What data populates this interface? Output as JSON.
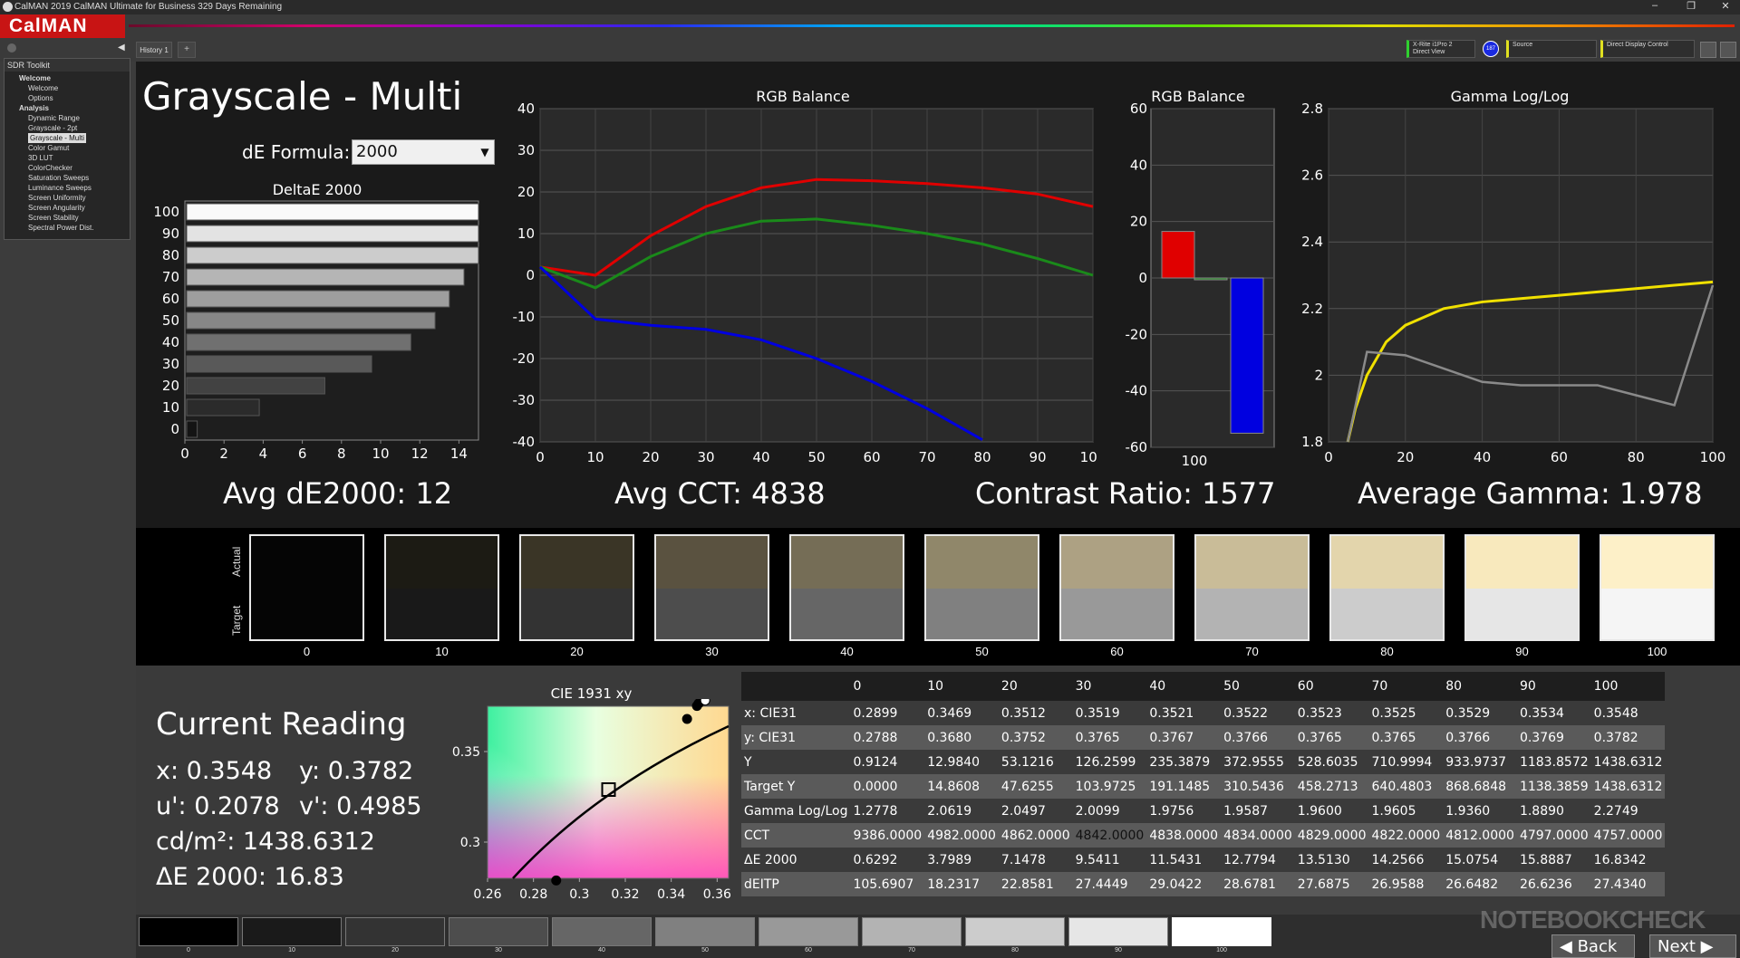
{
  "window": {
    "title": "CalMAN 2019 CalMAN Ultimate for Business 329 Days Remaining"
  },
  "brand": {
    "name": "CalMAN"
  },
  "sidebar": {
    "header": "SDR Toolkit",
    "items": [
      "Welcome",
      "Welcome",
      "Options",
      "Analysis",
      "Dynamic Range",
      "Grayscale - 2pt",
      "Grayscale - Multi",
      "Color Gamut",
      "3D LUT",
      "ColorChecker",
      "Saturation Sweeps",
      "Luminance Sweeps",
      "Screen Uniformity",
      "Screen Angularity",
      "Screen Stability",
      "Spectral Power Dist."
    ]
  },
  "tabs": {
    "history": "History 1",
    "add": "+"
  },
  "devices": {
    "meter": "X-Rite i1Pro 2",
    "meter_mode": "Direct View",
    "badge": "187",
    "source": "Source",
    "display": "Direct Display Control"
  },
  "page": {
    "title": "Grayscale - Multi",
    "de_formula_label": "dE Formula:",
    "de_formula_value": "2000"
  },
  "stats": {
    "avg_de": "Avg dE2000: 12",
    "avg_cct": "Avg CCT: 4838",
    "contrast": "Contrast Ratio: 1577",
    "avg_gamma": "Average Gamma: 1.978"
  },
  "colors": {
    "red": "#e00000",
    "green": "#1a8a1a",
    "blue": "#0000e0",
    "yellow": "#f0e000",
    "gray": "#8a8a8a",
    "brand": "#c81414"
  },
  "chart_data": [
    {
      "type": "bar",
      "title": "DeltaE 2000",
      "orientation": "horizontal",
      "categories": [
        "100",
        "90",
        "80",
        "70",
        "60",
        "50",
        "40",
        "30",
        "20",
        "10",
        "0"
      ],
      "values": [
        16.83,
        15.89,
        15.08,
        14.26,
        13.51,
        12.78,
        11.54,
        9.54,
        7.15,
        3.8,
        0.63
      ],
      "xlim": [
        0,
        15
      ],
      "xticks": [
        "0",
        "2",
        "4",
        "6",
        "8",
        "10",
        "12",
        "14"
      ]
    },
    {
      "type": "line",
      "title": "RGB Balance",
      "x": [
        0,
        10,
        20,
        30,
        40,
        50,
        60,
        70,
        80,
        90,
        100
      ],
      "series": [
        {
          "color": "red",
          "values": [
            2,
            0,
            9.5,
            16.5,
            21,
            23,
            22.7,
            22,
            21,
            19.5,
            16.5
          ]
        },
        {
          "color": "green",
          "values": [
            2,
            -3,
            4.5,
            10,
            13,
            13.5,
            12,
            10,
            7.5,
            4,
            0
          ]
        },
        {
          "color": "blue",
          "values": [
            2,
            -10.5,
            -12,
            -13,
            -15.5,
            -20,
            -25.5,
            -32,
            -39.5
          ]
        }
      ],
      "xlim": [
        0,
        100
      ],
      "ylim": [
        -40,
        40
      ],
      "xticks": [
        "0",
        "10",
        "20",
        "30",
        "40",
        "50",
        "60",
        "70",
        "80",
        "90",
        "100"
      ],
      "yticks": [
        "40",
        "30",
        "20",
        "10",
        "0",
        "-10",
        "-20",
        "-30",
        "-40"
      ]
    },
    {
      "type": "bar",
      "title": "RGB Balance",
      "categories": [
        "100"
      ],
      "series": [
        {
          "color": "red",
          "values": [
            16.5
          ]
        },
        {
          "color": "green",
          "values": [
            0
          ]
        },
        {
          "color": "blue",
          "values": [
            -55
          ]
        }
      ],
      "ylim": [
        -60,
        60
      ],
      "yticks": [
        "60",
        "40",
        "20",
        "0",
        "-20",
        "-40",
        "-60"
      ]
    },
    {
      "type": "line",
      "title": "Gamma Log/Log",
      "series": [
        {
          "color": "yellow",
          "x": [
            5,
            7,
            10,
            15,
            20,
            30,
            40,
            50,
            60,
            70,
            80,
            90,
            100
          ],
          "values": [
            1.8,
            1.9,
            2.0,
            2.1,
            2.15,
            2.2,
            2.22,
            2.23,
            2.24,
            2.25,
            2.26,
            2.27,
            2.28
          ]
        },
        {
          "color": "gray",
          "x": [
            5,
            10,
            20,
            30,
            40,
            50,
            60,
            70,
            80,
            90,
            100
          ],
          "values": [
            1.8,
            2.07,
            2.06,
            2.02,
            1.98,
            1.97,
            1.97,
            1.97,
            1.94,
            1.91,
            2.27
          ]
        }
      ],
      "xlim": [
        0,
        100
      ],
      "ylim": [
        1.8,
        2.8
      ],
      "xticks": [
        "0",
        "20",
        "40",
        "60",
        "80",
        "100"
      ],
      "yticks": [
        "2.8",
        "2.6",
        "2.4",
        "2.2",
        "2",
        "1.8"
      ]
    },
    {
      "type": "scatter",
      "title": "CIE 1931 xy",
      "xticks": [
        "0.26",
        "0.28",
        "0.3",
        "0.32",
        "0.34",
        "0.36"
      ],
      "yticks": [
        "0.35",
        "0.3"
      ],
      "xlim": [
        0.26,
        0.365
      ],
      "ylim": [
        0.28,
        0.375
      ],
      "points": [
        {
          "x": 0.2899,
          "y": 0.2788
        },
        {
          "x": 0.3469,
          "y": 0.368
        },
        {
          "x": 0.3512,
          "y": 0.3752
        },
        {
          "x": 0.3519,
          "y": 0.3765
        },
        {
          "x": 0.3521,
          "y": 0.3767
        },
        {
          "x": 0.3548,
          "y": 0.3782
        }
      ],
      "target": {
        "x": 0.3127,
        "y": 0.329
      }
    }
  ],
  "swatches": {
    "actual_label": "Actual",
    "target_label": "Target",
    "items": [
      {
        "label": "0",
        "actual": "#050505",
        "target": "#050505"
      },
      {
        "label": "10",
        "actual": "#1c1b14",
        "target": "#191919"
      },
      {
        "label": "20",
        "actual": "#3a3526",
        "target": "#333333"
      },
      {
        "label": "30",
        "actual": "#5a5240",
        "target": "#4d4d4d"
      },
      {
        "label": "40",
        "actual": "#756d56",
        "target": "#666666"
      },
      {
        "label": "50",
        "actual": "#90876a",
        "target": "#808080"
      },
      {
        "label": "60",
        "actual": "#ada183",
        "target": "#999999"
      },
      {
        "label": "70",
        "actual": "#c9bc98",
        "target": "#b3b3b3"
      },
      {
        "label": "80",
        "actual": "#e3d5ac",
        "target": "#cccccc"
      },
      {
        "label": "90",
        "actual": "#f8e9bd",
        "target": "#e6e6e6"
      },
      {
        "label": "100",
        "actual": "#fdf0c8",
        "target": "#f5f5f5"
      }
    ]
  },
  "current_reading": {
    "title": "Current Reading",
    "x": "x: 0.3548",
    "y": "y: 0.3782",
    "u": "u': 0.2078",
    "v": "v': 0.4985",
    "cd": "cd/m²: 1438.6312",
    "de": "ΔE 2000: 16.83"
  },
  "table": {
    "headers": [
      "",
      "0",
      "10",
      "20",
      "30",
      "40",
      "50",
      "60",
      "70",
      "80",
      "90",
      "100"
    ],
    "rows": [
      [
        "x: CIE31",
        "0.2899",
        "0.3469",
        "0.3512",
        "0.3519",
        "0.3521",
        "0.3522",
        "0.3523",
        "0.3525",
        "0.3529",
        "0.3534",
        "0.3548"
      ],
      [
        "y: CIE31",
        "0.2788",
        "0.3680",
        "0.3752",
        "0.3765",
        "0.3767",
        "0.3766",
        "0.3765",
        "0.3765",
        "0.3766",
        "0.3769",
        "0.3782"
      ],
      [
        "Y",
        "0.9124",
        "12.9840",
        "53.1216",
        "126.2599",
        "235.3879",
        "372.9555",
        "528.6035",
        "710.9994",
        "933.9737",
        "1183.8572",
        "1438.6312"
      ],
      [
        "Target Y",
        "0.0000",
        "14.8608",
        "47.6255",
        "103.9725",
        "191.1485",
        "310.5436",
        "458.2713",
        "640.4803",
        "868.6848",
        "1138.3859",
        "1438.6312"
      ],
      [
        "Gamma Log/Log",
        "1.2778",
        "2.0619",
        "2.0497",
        "2.0099",
        "1.9756",
        "1.9587",
        "1.9600",
        "1.9605",
        "1.9360",
        "1.8890",
        "2.2749"
      ],
      [
        "CCT",
        "9386.0000",
        "4982.0000",
        "4862.0000",
        "4842.0000",
        "4838.0000",
        "4834.0000",
        "4829.0000",
        "4822.0000",
        "4812.0000",
        "4797.0000",
        "4757.0000"
      ],
      [
        "ΔE 2000",
        "0.6292",
        "3.7989",
        "7.1478",
        "9.5411",
        "11.5431",
        "12.7794",
        "13.5130",
        "14.2566",
        "15.0754",
        "15.8887",
        "16.8342"
      ],
      [
        "dEITP",
        "105.6907",
        "18.2317",
        "22.8581",
        "27.4449",
        "29.0422",
        "28.6781",
        "27.6875",
        "26.9588",
        "26.6482",
        "26.6236",
        "27.4340"
      ]
    ]
  },
  "patches": {
    "labels": [
      "0",
      "10",
      "20",
      "30",
      "40",
      "50",
      "60",
      "70",
      "80",
      "90",
      "100"
    ],
    "colors": [
      "#000000",
      "#1a1a1a",
      "#333333",
      "#4d4d4d",
      "#666666",
      "#808080",
      "#999999",
      "#b3b3b3",
      "#cccccc",
      "#e6e6e6",
      "#ffffff"
    ]
  },
  "nav": {
    "back": "Back",
    "next": "Next"
  },
  "watermark": "NOTEBOOKCHECK"
}
